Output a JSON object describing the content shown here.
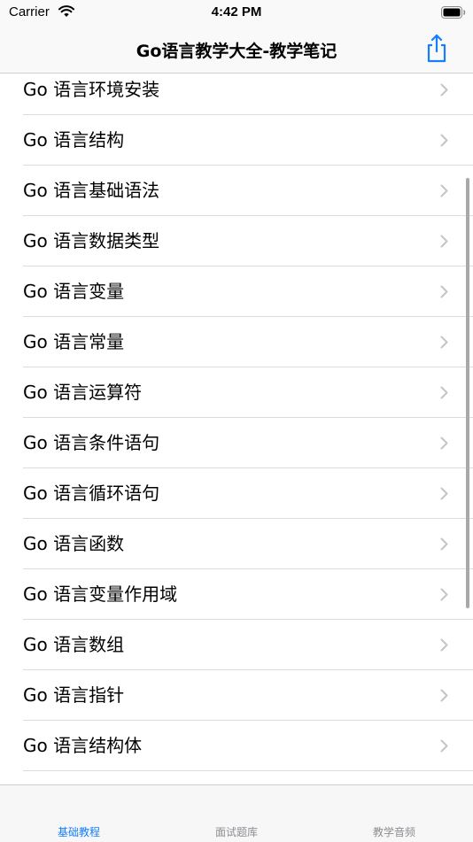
{
  "status_bar": {
    "carrier": "Carrier",
    "time": "4:42 PM"
  },
  "nav": {
    "title": "Go语言教学大全-教学笔记",
    "share_icon": "share-icon"
  },
  "list": {
    "items": [
      {
        "label": "Go 语言环境安装"
      },
      {
        "label": "Go 语言结构"
      },
      {
        "label": "Go 语言基础语法"
      },
      {
        "label": "Go 语言数据类型"
      },
      {
        "label": "Go 语言变量"
      },
      {
        "label": "Go 语言常量"
      },
      {
        "label": "Go 语言运算符"
      },
      {
        "label": "Go 语言条件语句"
      },
      {
        "label": "Go 语言循环语句"
      },
      {
        "label": "Go 语言函数"
      },
      {
        "label": "Go 语言变量作用域"
      },
      {
        "label": "Go 语言数组"
      },
      {
        "label": "Go 语言指针"
      },
      {
        "label": "Go 语言结构体"
      }
    ]
  },
  "tabs": [
    {
      "label": "基础教程",
      "active": true
    },
    {
      "label": "面试题库",
      "active": false
    },
    {
      "label": "教学音频",
      "active": false
    }
  ],
  "colors": {
    "accent": "#147efb",
    "inactive": "#8e8e93"
  }
}
